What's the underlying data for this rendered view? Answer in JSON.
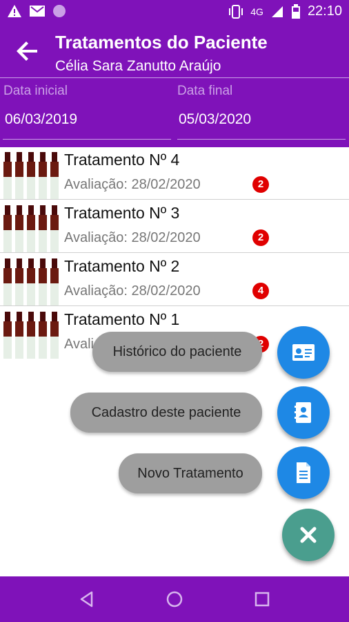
{
  "status_bar": {
    "time": "22:10",
    "network": "4G",
    "icons_left": [
      "warning-icon",
      "gmail-icon",
      "circle-dot-icon"
    ],
    "icons_right": [
      "vibrate-icon",
      "signal-icon",
      "battery-icon"
    ]
  },
  "app_bar": {
    "title": "Tratamentos do Paciente",
    "subtitle": "Célia Sara Zanutto Araújo"
  },
  "filters": {
    "start_label": "Data inicial",
    "start_value": "06/03/2019",
    "end_label": "Data final",
    "end_value": "05/03/2020"
  },
  "treatments": [
    {
      "title": "Tratamento Nº 4",
      "evaluation": "Avaliação: 28/02/2020",
      "badge": "2"
    },
    {
      "title": "Tratamento Nº 3",
      "evaluation": "Avaliação: 28/02/2020",
      "badge": "2"
    },
    {
      "title": "Tratamento Nº 2",
      "evaluation": "Avaliação: 28/02/2020",
      "badge": "4"
    },
    {
      "title": "Tratamento Nº 1",
      "evaluation": "Avaliação: 28/02/2020",
      "badge": "2"
    }
  ],
  "fab_menu": {
    "history_label": "Histórico do paciente",
    "register_label": "Cadastro deste paciente",
    "new_treatment_label": "Novo Tratamento"
  },
  "colors": {
    "primary": "#7f12b9",
    "fab": "#1e88e5",
    "fab_close": "#4a9e8e",
    "badge": "#e00000"
  }
}
